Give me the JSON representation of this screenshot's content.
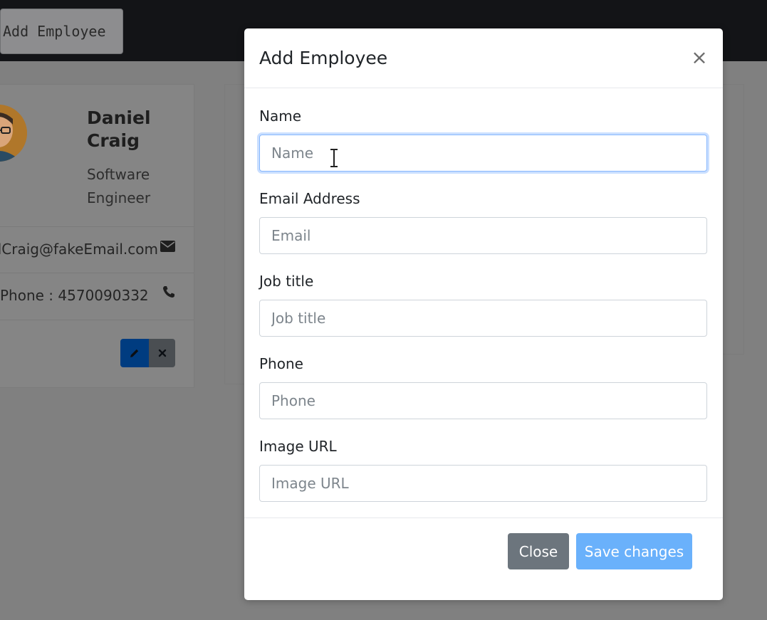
{
  "navbar": {
    "add_button_label": "Add Employee"
  },
  "employee_card": {
    "name": "Daniel Craig",
    "job_title": "Software Engineer",
    "email": "DanielCraig@fakeEmail.com",
    "phone": "Phone : 4570090332",
    "edit_icon": "pencil-icon",
    "delete_icon": "x-icon",
    "email_icon": "envelope-icon",
    "phone_icon": "phone-icon"
  },
  "modal": {
    "title": "Add Employee",
    "close_glyph": "×",
    "fields": [
      {
        "label": "Name",
        "placeholder": "Name",
        "value": ""
      },
      {
        "label": "Email Address",
        "placeholder": "Email",
        "value": ""
      },
      {
        "label": "Job title",
        "placeholder": "Job title",
        "value": ""
      },
      {
        "label": "Phone",
        "placeholder": "Phone",
        "value": ""
      },
      {
        "label": "Image URL",
        "placeholder": "Image URL",
        "value": ""
      }
    ],
    "close_button_label": "Close",
    "save_button_label": "Save changes"
  },
  "colors": {
    "backdrop": "#808080",
    "navbar": "#131417",
    "primary_disabled": "#6ab1fb",
    "secondary": "#6c757d",
    "focus_border": "#86b7fe"
  }
}
